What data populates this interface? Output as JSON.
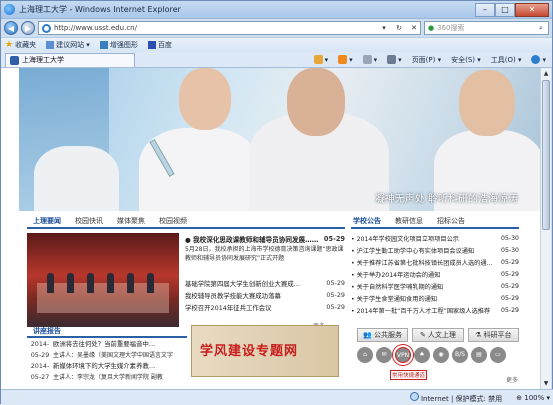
{
  "window": {
    "title": "上海理工大学 - Windows Internet Explorer",
    "controls": [
      "–",
      "□",
      "✕"
    ]
  },
  "address": {
    "url": "http://www.usst.edu.cn/",
    "search_placeholder": "360搜索"
  },
  "favorites": {
    "label": "收藏夹",
    "items": [
      "建议网站 ▾",
      "增强图形",
      "百度"
    ]
  },
  "tab": {
    "label": "上海理工大学"
  },
  "commands": [
    "页面(P) ▾",
    "安全(S) ▾",
    "工具(O) ▾"
  ],
  "hero": {
    "slogan": "凝神无声处  聆听科研的浩海惊涛"
  },
  "news": {
    "tabs": [
      "上理要闻",
      "校园快讯",
      "媒体聚焦",
      "校园视频"
    ],
    "rows": [
      {
        "text": "● 我校深化思政课教师和辅导员协同发展……",
        "date": "05-29",
        "head": true
      },
      {
        "text": "基础学院第四届大学生创新创业大赛成…",
        "date": "05-29"
      },
      {
        "text": "我校辅导员教学技能大赛成功落幕",
        "date": "05-29"
      },
      {
        "text": "学校召开2014年征兵工作会议",
        "date": "05-29"
      }
    ],
    "desc": "5月28日，我校承担的上海市学校德育决策咨询课题“思政课教师和辅导员协同发展研究”正式开题",
    "more": "更多"
  },
  "lecture": {
    "title": "讲座报告",
    "rows": [
      {
        "date": "2014-",
        "text": "欧洲将去往何处？当前重要福音中…"
      },
      {
        "date": "05-29",
        "text": "主讲人：吴墨缘（美国文理大学中国语言文字",
        "sub": true
      },
      {
        "date": "2014-",
        "text": "新媒体环境下的大学生媒介素养教…"
      },
      {
        "date": "05-27",
        "text": "主讲人：李宗龙（复旦大学新闻学院 副教",
        "sub": true
      }
    ]
  },
  "banner": {
    "text": "学风建设专题网"
  },
  "notices": {
    "tabs": [
      "学校公告",
      "教研信息",
      "招标公告"
    ],
    "rows": [
      {
        "text": "• 2014年学校园文化项目立项项目公示",
        "date": "05-30"
      },
      {
        "text": "• 沪江学生勤工助学中心有实体项目会议通知",
        "date": "05-30"
      },
      {
        "text": "• 关于推荐江苏省第七批科技镇长团成员人选的通…",
        "date": "05-29"
      },
      {
        "text": "• 关于举办2014年运动会的通知",
        "date": "05-29"
      },
      {
        "text": "• 关于自然科学医学哺乳期的通知",
        "date": "05-29"
      },
      {
        "text": "• 关于学生食堂通知食用的通知",
        "date": "05-29"
      },
      {
        "text": "• 2014年第一批“百千万人才工程”国家级人选推荐",
        "date": "05-29"
      }
    ],
    "more": "更多"
  },
  "services": {
    "tabs": [
      "公共服务",
      "人文上理",
      "科研平台"
    ],
    "icons": [
      "⌂",
      "✉",
      "VPN",
      "♠",
      "◉",
      "B/S",
      "▤",
      "▭"
    ],
    "label": "常用快捷通道"
  },
  "status": {
    "zone": "Internet | 保护模式: 禁用",
    "zoom": "100%"
  }
}
